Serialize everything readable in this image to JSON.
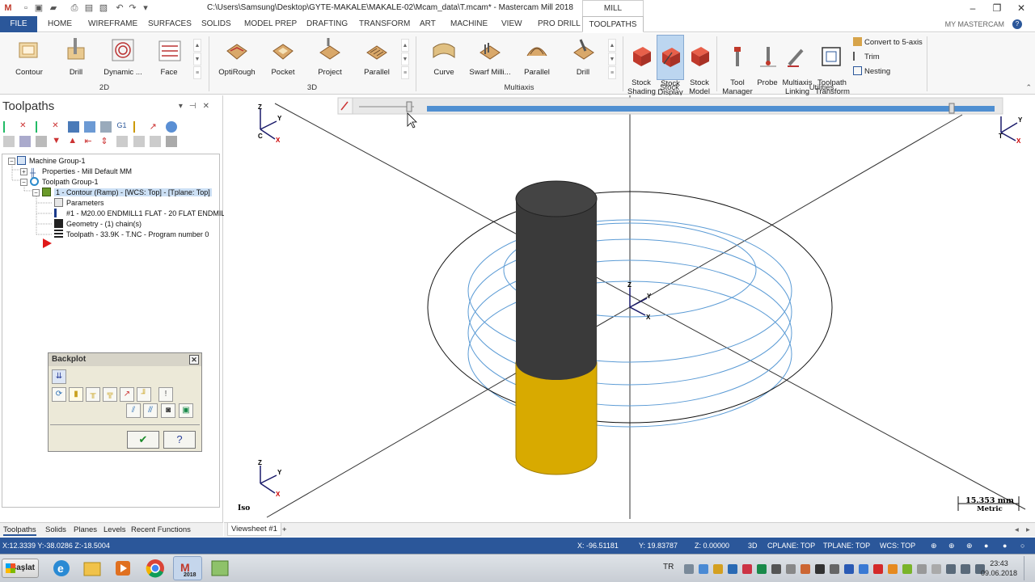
{
  "titlebar": {
    "title": "C:\\Users\\Samsung\\Desktop\\GYTE-MAKALE\\MAKALE-02\\Mcam_data\\T.mcam* - Mastercam Mill 2018",
    "context_tab": "MILL",
    "minimize": "–",
    "maximize": "❐",
    "close": "✕"
  },
  "ribbon_tabs": [
    "FILE",
    "HOME",
    "WIREFRAME",
    "SURFACES",
    "SOLIDS",
    "MODEL PREP",
    "DRAFTING",
    "TRANSFORM",
    "ART",
    "MACHINE",
    "VIEW",
    "PRO DRILL",
    "TOOLPATHS"
  ],
  "active_tab": "TOOLPATHS",
  "my_mastercam": "MY MASTERCAM",
  "help": "?",
  "ribbon": {
    "group_2d": {
      "label": "2D",
      "buttons": [
        "Contour",
        "Drill",
        "Dynamic ...",
        "Face"
      ]
    },
    "group_3d": {
      "label": "3D",
      "buttons": [
        "OptiRough",
        "Pocket",
        "Project",
        "Parallel"
      ]
    },
    "group_multiaxis": {
      "label": "Multiaxis",
      "buttons": [
        "Curve",
        "Swarf Milli...",
        "Parallel",
        "Drill"
      ]
    },
    "group_stock": {
      "label": "Stock",
      "buttons": [
        "Stock\nShading",
        "Stock\nDisplay",
        "Stock\nModel"
      ]
    },
    "group_utilities": {
      "label": "Utilities",
      "buttons": [
        "Tool\nManager",
        "Probe",
        "Multiaxis\nLinking",
        "Toolpath\nTransform"
      ],
      "small_buttons": [
        "Convert to 5-axis",
        "Trim",
        "Nesting"
      ]
    }
  },
  "toolpaths_panel": {
    "title": "Toolpaths",
    "tree": [
      {
        "label": "Machine Group-1",
        "level": 0
      },
      {
        "label": "Properties - Mill Default MM",
        "level": 1
      },
      {
        "label": "Toolpath Group-1",
        "level": 1
      },
      {
        "label": "1 - Contour (Ramp) - [WCS: Top] - [Tplane: Top]",
        "level": 2,
        "selected": true
      },
      {
        "label": "Parameters",
        "level": 3
      },
      {
        "label": "#1 - M20.00 ENDMILL1 FLAT - 20 FLAT ENDMILL",
        "level": 3
      },
      {
        "label": "Geometry -  (1) chain(s)",
        "level": 3
      },
      {
        "label": "Toolpath - 33.9K - T.NC - Program number 0",
        "level": 3
      }
    ]
  },
  "backplot": {
    "title": "Backplot",
    "ok": "✔",
    "help": "?"
  },
  "bottom_tabs": [
    "Toolpaths",
    "Solids",
    "Planes",
    "Levels",
    "Recent Functions"
  ],
  "viewsheet": {
    "tab": "Viewsheet #1",
    "add": "+"
  },
  "viewport": {
    "view_label": "Iso",
    "scale": "15.353 mm",
    "units": "Metric",
    "axis_labels": {
      "z": "Z",
      "y": "Y",
      "x": "X",
      "c": "C",
      "t": "T"
    },
    "tool_color": "#3a3a3a",
    "stock_color": "#e6b800",
    "toolpath_color": "#5b9bd5"
  },
  "statusbar": {
    "left": "X:12.3339   Y:-38.0286   Z:-18.5004",
    "x": "X:   -96.51181",
    "y": "Y:   19.83787",
    "z": "Z:   0.00000",
    "mode": "3D",
    "cplane": "CPLANE: TOP",
    "tplane": "TPLANE: TOP",
    "wcs": "WCS: TOP"
  },
  "taskbar": {
    "start": "Başlat",
    "lang": "TR",
    "time": "23:43",
    "date": "09.06.2018",
    "mastercam_label": "2018"
  }
}
